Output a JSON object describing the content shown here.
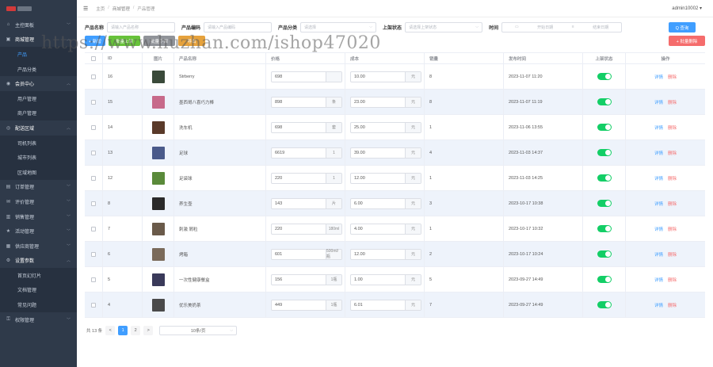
{
  "sidebar": {
    "items": [
      {
        "label": "主控面板",
        "icon": "home-icon",
        "type": "top"
      },
      {
        "label": "商城管理",
        "icon": "shop-icon",
        "type": "top-open"
      },
      {
        "label": "产品",
        "type": "sub-active"
      },
      {
        "label": "产品分类",
        "type": "sub"
      },
      {
        "label": "会员中心",
        "icon": "user-icon",
        "type": "top-open"
      },
      {
        "label": "用户管理",
        "type": "sub"
      },
      {
        "label": "商户管理",
        "type": "sub"
      },
      {
        "label": "配送区域",
        "icon": "location-icon",
        "type": "top-open"
      },
      {
        "label": "司机列表",
        "type": "sub"
      },
      {
        "label": "城市列表",
        "type": "sub"
      },
      {
        "label": "区域地图",
        "type": "sub"
      },
      {
        "label": "订单管理",
        "icon": "order-icon",
        "type": "top"
      },
      {
        "label": "评价管理",
        "icon": "comment-icon",
        "type": "top"
      },
      {
        "label": "销售管理",
        "icon": "sales-icon",
        "type": "top"
      },
      {
        "label": "活动管理",
        "icon": "activity-icon",
        "type": "top"
      },
      {
        "label": "供应商管理",
        "icon": "supplier-icon",
        "type": "top"
      },
      {
        "label": "设置参数",
        "icon": "settings-icon",
        "type": "top-open"
      },
      {
        "label": "首页幻灯片",
        "type": "sub"
      },
      {
        "label": "文档管理",
        "type": "sub"
      },
      {
        "label": "常见问题",
        "type": "sub"
      },
      {
        "label": "权限管理",
        "icon": "permission-icon",
        "type": "top"
      }
    ]
  },
  "header": {
    "breadcrumb": [
      "主页",
      "商城管理",
      "产品管理"
    ],
    "user": "admin10002 ▾"
  },
  "filters": {
    "name_label": "产品名称",
    "name_placeholder": "请输入产品名称",
    "code_label": "产品编码",
    "code_placeholder": "请输入产品编码",
    "category_label": "产品分类",
    "category_placeholder": "请选择",
    "status_label": "上架状态",
    "status_placeholder": "请选择上架状态",
    "time_label": "时间",
    "start_placeholder": "开始日期",
    "end_placeholder": "结束日期",
    "query_label": "Q 查询"
  },
  "actions": {
    "add": "+ 新增",
    "green": "批量上架",
    "gray": "批量下架",
    "orange": "导出",
    "batch_delete": "+ 批量删除"
  },
  "table": {
    "headers": [
      "",
      "ID",
      "图片",
      "产品名称",
      "价格",
      "成本",
      "销量",
      "发布时间",
      "上架状态",
      "操作"
    ],
    "rows": [
      {
        "id": "16",
        "name": "Strberry",
        "price": "698",
        "price_unit": "",
        "cost": "10.00",
        "sold": "8",
        "time": "2023-11-07 11:20",
        "thumb": "#3a4a3a"
      },
      {
        "id": "15",
        "name": "墨西哥八喜巧力棒",
        "price": "898",
        "price_unit": "条",
        "cost": "23.00",
        "sold": "8",
        "time": "2023-11-07 11:19",
        "thumb": "#c76a8a"
      },
      {
        "id": "14",
        "name": "洗车机",
        "price": "698",
        "price_unit": "套",
        "cost": "25.00",
        "sold": "1",
        "time": "2023-11-06 13:55",
        "thumb": "#5a3a2a"
      },
      {
        "id": "13",
        "name": "足球",
        "price": "6619",
        "price_unit": "1",
        "cost": "39.00",
        "sold": "4",
        "time": "2023-11-03 14:37",
        "thumb": "#4a5a8a"
      },
      {
        "id": "12",
        "name": "足袋球",
        "price": "220",
        "price_unit": "1",
        "cost": "12.00",
        "sold": "1",
        "time": "2023-11-03 14:25",
        "thumb": "#5a8a3a"
      },
      {
        "id": "8",
        "name": "养生壶",
        "price": "143",
        "price_unit": "片",
        "cost": "6.00",
        "sold": "3",
        "time": "2023-10-17 10:38",
        "thumb": "#2a2a2a"
      },
      {
        "id": "7",
        "name": "刺激 屑粒",
        "price": "220",
        "price_unit": "180ml",
        "cost": "4.00",
        "sold": "1",
        "time": "2023-10-17 10:32",
        "thumb": "#6a5a4a"
      },
      {
        "id": "6",
        "name": "烤箱",
        "price": "601",
        "price_unit": "500ml/瓶",
        "cost": "12.00",
        "sold": "2",
        "time": "2023-10-17 10:24",
        "thumb": "#7a6a5a"
      },
      {
        "id": "5",
        "name": "一次性健康餐盒",
        "price": "156",
        "price_unit": "1瓶",
        "cost": "1.00",
        "sold": "5",
        "time": "2023-09-27 14:49",
        "thumb": "#3a3a5a"
      },
      {
        "id": "4",
        "name": "优乐美奶茶",
        "price": "449",
        "price_unit": "1瓶",
        "cost": "6.01",
        "sold": "7",
        "time": "2023-09-27 14:49",
        "thumb": "#4a4a4a"
      }
    ],
    "cost_unit": "元",
    "op_detail": "详情",
    "op_delete": "删除"
  },
  "pagination": {
    "total": "共 13 条",
    "prev": "<",
    "pages": [
      "1",
      "2"
    ],
    "next": ">",
    "size": "10条/页"
  },
  "watermark": "https://www.huzhan.com/ishop47020"
}
